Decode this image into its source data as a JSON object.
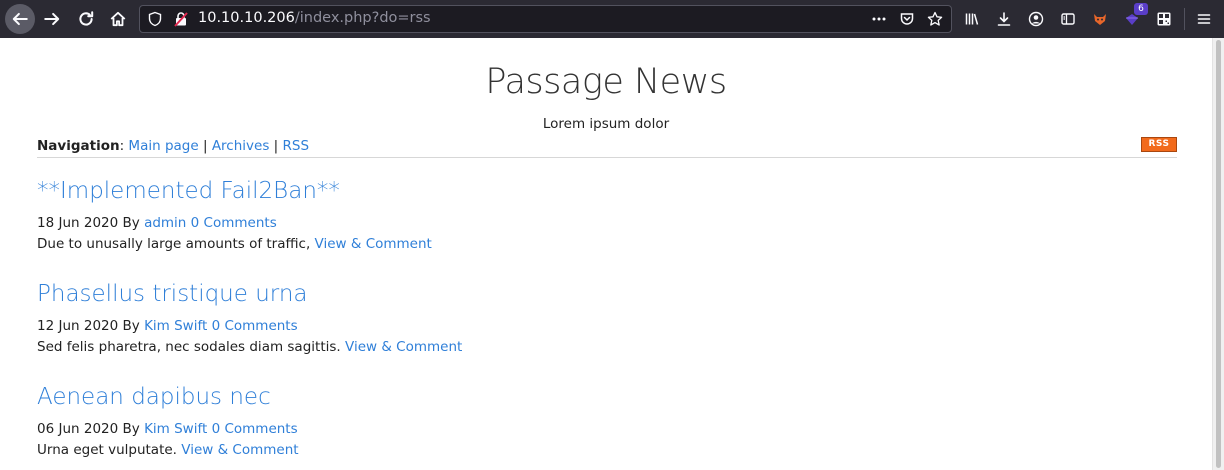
{
  "browser": {
    "url_host": "10.10.10.206",
    "url_path": "/index.php?do=rss",
    "extension_badge": "6",
    "colors": {
      "chrome": "#2b2a33",
      "urlbar": "#1c1b22"
    }
  },
  "site": {
    "title": "Passage News",
    "subtitle": "Lorem ipsum dolor",
    "nav_label": "Navigation",
    "nav_links": [
      "Main page",
      "Archives",
      "RSS"
    ],
    "rss_badge": "RSS",
    "link_color": "#2f7fd8"
  },
  "posts": [
    {
      "title": "**Implemented Fail2Ban**",
      "date": "18 Jun 2020 By",
      "author": "admin",
      "comments": "0 Comments",
      "excerpt": "Due to unusally large amounts of traffic,",
      "action": "View & Comment"
    },
    {
      "title": "Phasellus tristique urna",
      "date": "12 Jun 2020 By",
      "author": "Kim Swift",
      "comments": "0 Comments",
      "excerpt": "Sed felis pharetra, nec sodales diam sagittis.",
      "action": "View & Comment"
    },
    {
      "title": "Aenean dapibus nec",
      "date": "06 Jun 2020 By",
      "author": "Kim Swift",
      "comments": "0 Comments",
      "excerpt": "Urna eget vulputate.",
      "action": "View & Comment"
    }
  ]
}
